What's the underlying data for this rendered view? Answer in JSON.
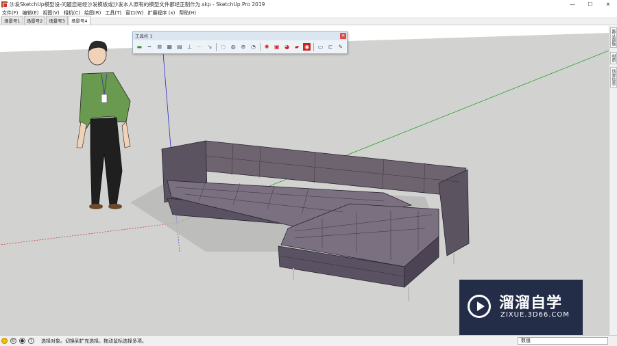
{
  "window": {
    "title": "沙发SketchUp模型设-问题您是经沙发模板或沙发本人原有的模型文件都经正制作为.skp - SketchUp Pro 2019",
    "controls": [
      "—",
      "☐",
      "✕"
    ]
  },
  "menu": [
    "文件(F)",
    "编辑(E)",
    "视图(V)",
    "相机(C)",
    "绘图(R)",
    "工具(T)",
    "窗口(W)",
    "扩展程序 (x)",
    "帮助(H)"
  ],
  "scene_tabs": [
    {
      "label": "场景号1",
      "active": false
    },
    {
      "label": "场景号2",
      "active": false
    },
    {
      "label": "场景号3",
      "active": false
    },
    {
      "label": "场景号4",
      "active": true
    }
  ],
  "floating_toolbar": {
    "title": "工具栏 1",
    "close": "×",
    "icons": [
      "align-icon",
      "align-center-icon",
      "move-icon",
      "grid-icon",
      "array-icon",
      "level-icon",
      "dot-icon",
      "snap-icon",
      "rotate-icon",
      "zoom-icon",
      "search-icon",
      "orbit-icon",
      "sun-icon",
      "render-icon",
      "material-icon",
      "camera-icon",
      "render-red-icon",
      "folder-icon",
      "folder-open-icon",
      "eyedropper-icon"
    ]
  },
  "right_tray": [
    "默认面板",
    "材质",
    "场景信息"
  ],
  "viewport": {
    "background_color": "#ffffff",
    "ground_color": "#d2d2d0",
    "sofa_color": "#6e6470",
    "axis_red": "#cc2a2a",
    "axis_green": "#2aa02a",
    "axis_blue": "#2a2acc"
  },
  "watermark": {
    "cn": "溜溜自学",
    "en": "ZIXUE.3D66.COM"
  },
  "status": {
    "message": "选择对象。切换到扩充选择。拖动鼠标选择多项。",
    "measure_label": "数值"
  }
}
